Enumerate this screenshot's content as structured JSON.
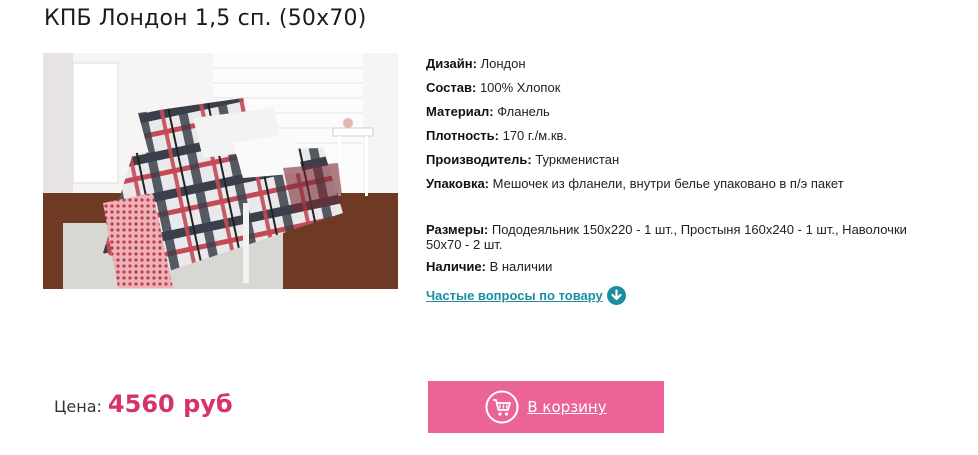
{
  "product": {
    "title": "КПБ Лондон 1,5 сп. (50х70)"
  },
  "specs": [
    {
      "label": "Дизайн:",
      "value": "Лондон"
    },
    {
      "label": "Состав:",
      "value": "100% Хлопок"
    },
    {
      "label": "Материал:",
      "value": "Фланель"
    },
    {
      "label": "Плотность:",
      "value": "170 г./м.кв."
    },
    {
      "label": "Производитель:",
      "value": "Туркменистан"
    },
    {
      "label": "Упаковка:",
      "value": "Мешочек из фланели, внутри белье упаковано в п/э пакет"
    },
    {
      "label": "Размеры:",
      "value": "Пододеяльник 150х220 - 1 шт., Простыня 160х240 - 1 шт., Наволочки 50х70 - 2 шт."
    },
    {
      "label": "Наличие:",
      "value": "В наличии"
    }
  ],
  "faq_link": {
    "label": "Частые вопросы по товару",
    "icon": "download-arrow-icon"
  },
  "price": {
    "label": "Цена:",
    "value": "4560 руб"
  },
  "cart_button": {
    "label": "В корзину",
    "icon": "cart-icon"
  },
  "colors": {
    "accent": "#ec6497",
    "price": "#d6336c",
    "link": "#1a8fa0"
  }
}
